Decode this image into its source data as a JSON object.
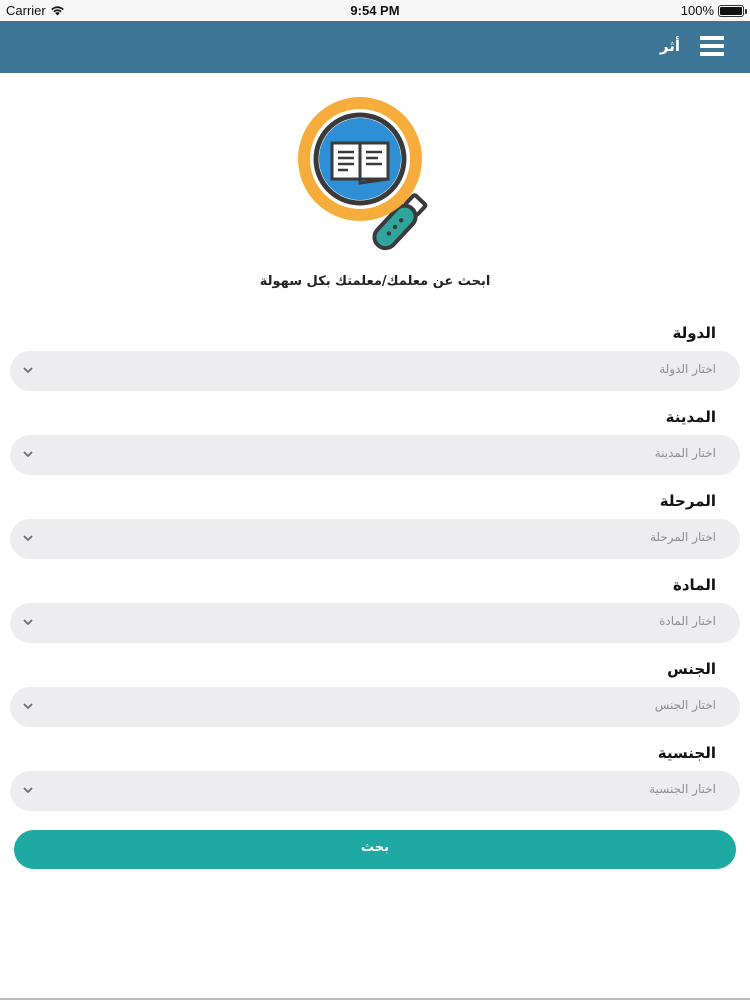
{
  "status_bar": {
    "carrier": "Carrier",
    "time": "9:54 PM",
    "battery": "100%",
    "battery_level": 1.0
  },
  "nav": {
    "title": "أثر",
    "menu_icon": "hamburger-menu-icon",
    "background_color": "#3d7596"
  },
  "hero": {
    "logo_icon": "magnifier-book-icon",
    "tagline": "ابحث عن معلمك/معلمتك بكل سهولة"
  },
  "form": {
    "fields": [
      {
        "label": "الدولة",
        "placeholder": "اختار الدولة"
      },
      {
        "label": "المدينة",
        "placeholder": "اختار المدينة"
      },
      {
        "label": "المرحلة",
        "placeholder": "اختار المرحلة"
      },
      {
        "label": "المادة",
        "placeholder": "اختار المادة"
      },
      {
        "label": "الجنس",
        "placeholder": "اختار الجنس"
      },
      {
        "label": "الجنسية",
        "placeholder": "اختار الجنسية"
      }
    ],
    "submit_label": "بحث",
    "submit_color": "#1eaaa2"
  }
}
